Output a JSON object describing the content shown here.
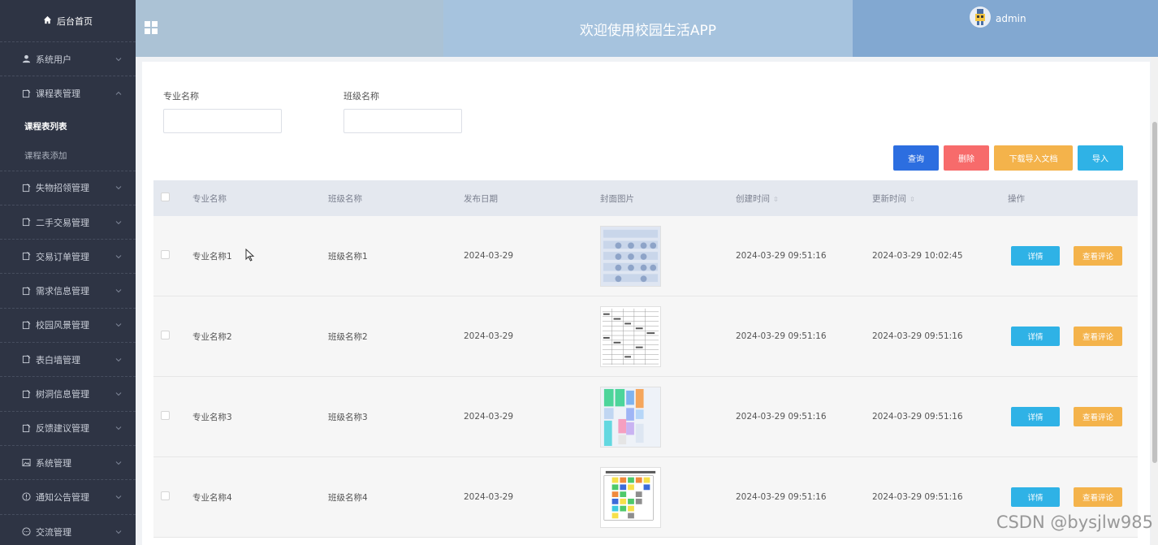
{
  "sidebar": {
    "home_label": "后台首页",
    "items": [
      {
        "label": "系统用户",
        "icon": "user-icon",
        "expanded": false
      },
      {
        "label": "课程表管理",
        "icon": "doc-icon",
        "expanded": true,
        "children": [
          {
            "label": "课程表列表",
            "active": true
          },
          {
            "label": "课程表添加",
            "active": false
          }
        ]
      },
      {
        "label": "失物招领管理",
        "icon": "doc-icon",
        "expanded": false
      },
      {
        "label": "二手交易管理",
        "icon": "doc-icon",
        "expanded": false
      },
      {
        "label": "交易订单管理",
        "icon": "doc-icon",
        "expanded": false
      },
      {
        "label": "需求信息管理",
        "icon": "doc-icon",
        "expanded": false
      },
      {
        "label": "校园风景管理",
        "icon": "doc-icon",
        "expanded": false
      },
      {
        "label": "表白墙管理",
        "icon": "doc-icon",
        "expanded": false
      },
      {
        "label": "树洞信息管理",
        "icon": "doc-icon",
        "expanded": false
      },
      {
        "label": "反馈建议管理",
        "icon": "doc-icon",
        "expanded": false
      },
      {
        "label": "系统管理",
        "icon": "image-icon",
        "expanded": false
      },
      {
        "label": "通知公告管理",
        "icon": "info-icon",
        "expanded": false
      },
      {
        "label": "交流管理",
        "icon": "chat-icon",
        "expanded": false
      }
    ]
  },
  "header": {
    "title": "欢迎使用校园生活APP",
    "username": "admin"
  },
  "search": {
    "major_label": "专业名称",
    "major_value": "",
    "class_label": "班级名称",
    "class_value": ""
  },
  "actions": {
    "query": "查询",
    "delete": "删除",
    "download": "下载导入文档",
    "import": "导入"
  },
  "table": {
    "columns": [
      "专业名称",
      "班级名称",
      "发布日期",
      "封面图片",
      "创建时间",
      "更新时间",
      "操作"
    ],
    "sort_glyph": "⇳",
    "detail_label": "详情",
    "comment_label": "查看评论",
    "rows": [
      {
        "major": "专业名称1",
        "class": "班级名称1",
        "date": "2024-03-29",
        "created": "2024-03-29 09:51:16",
        "updated": "2024-03-29 10:02:45"
      },
      {
        "major": "专业名称2",
        "class": "班级名称2",
        "date": "2024-03-29",
        "created": "2024-03-29 09:51:16",
        "updated": "2024-03-29 09:51:16"
      },
      {
        "major": "专业名称3",
        "class": "班级名称3",
        "date": "2024-03-29",
        "created": "2024-03-29 09:51:16",
        "updated": "2024-03-29 09:51:16"
      },
      {
        "major": "专业名称4",
        "class": "班级名称4",
        "date": "2024-03-29",
        "created": "2024-03-29 09:51:16",
        "updated": "2024-03-29 09:51:16"
      }
    ]
  },
  "watermark": "CSDN @bysjlw985",
  "colors": {
    "sidebar_bg": "#2e3444",
    "header_left": "#abc2d5",
    "header_mid": "#a6c3de",
    "header_right": "#82a8d1",
    "query": "#2c6ee0",
    "delete": "#f76b6b",
    "download": "#f4b34b",
    "import": "#2fb2e6"
  }
}
